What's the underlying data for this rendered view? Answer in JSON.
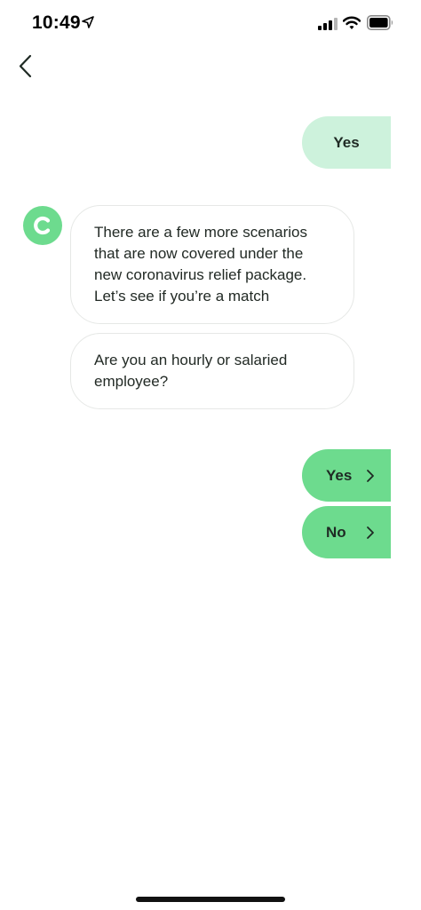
{
  "status_bar": {
    "time": "10:49"
  },
  "conversation": {
    "user_reply": "Yes",
    "bot_messages": [
      "There are a few more scenarios that are now covered under the new coronavirus relief package. Let’s see if you’re a match",
      "Are you an hourly or salaried employee?"
    ],
    "options": [
      {
        "label": "Yes"
      },
      {
        "label": "No"
      }
    ]
  },
  "colors": {
    "accent_green": "#6ddb8e",
    "light_green": "#cdf2dc",
    "bubble_border": "#e6e8e6"
  },
  "icons": {
    "back": "chevron-left-icon",
    "avatar_letter": "c-letter-icon",
    "option_arrow": "chevron-right-icon"
  }
}
